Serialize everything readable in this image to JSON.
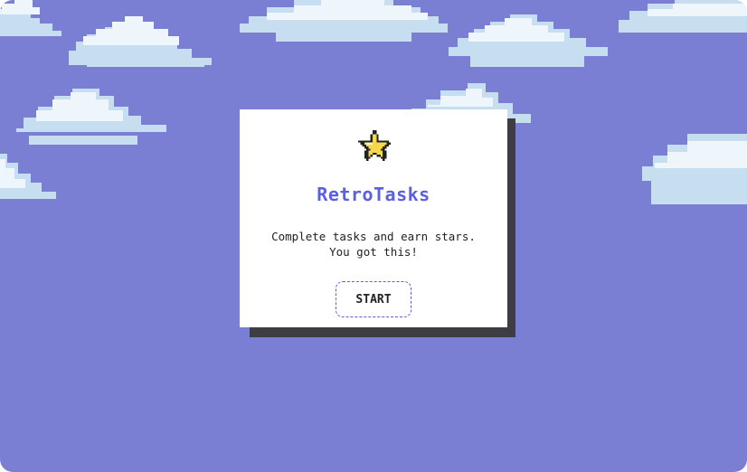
{
  "app": {
    "title": "RetroTasks",
    "tagline_line1": "Complete tasks and earn stars.",
    "tagline_line2": "You got this!",
    "start_label": "START",
    "icon": "star-icon"
  },
  "colors": {
    "sky": "#7b7fd4",
    "accent": "#5b5fe0",
    "card": "#ffffff",
    "card_shadow": "#3f3d44",
    "star": "#f5d94a",
    "cloud_light": "#eef6fb",
    "cloud_mid": "#c6def0"
  }
}
